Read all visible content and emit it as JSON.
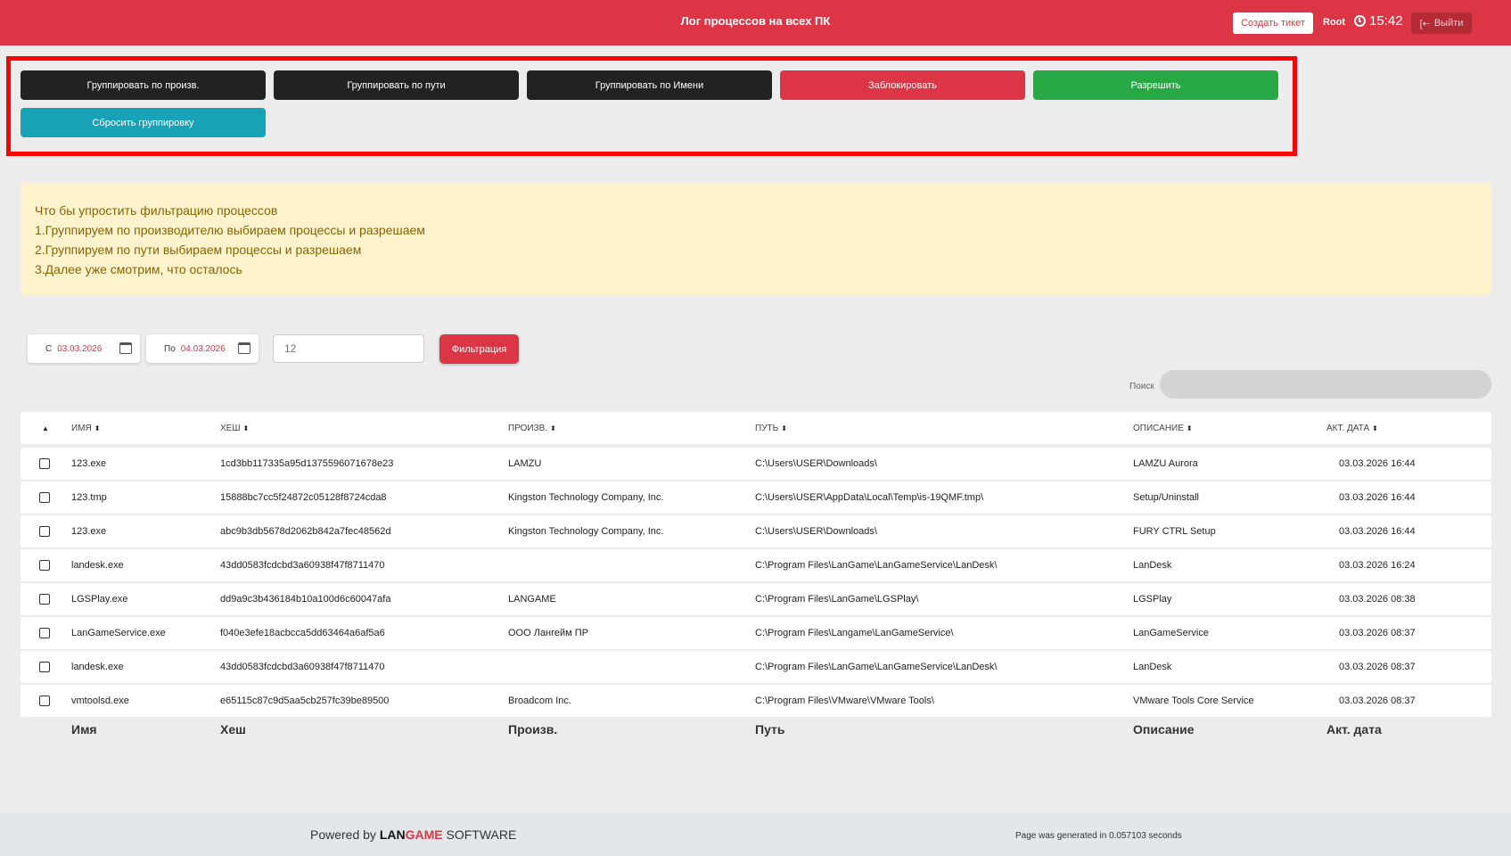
{
  "header": {
    "title": "Лог процессов на всех ПК",
    "create_ticket": "Создать тикет",
    "user": "Root",
    "time": "15:42",
    "logout": "Выйти"
  },
  "actions": {
    "group_by_vendor": "Группировать по произв.",
    "group_by_path": "Группировать по пути",
    "group_by_name": "Группировать по Имени",
    "block": "Заблокировать",
    "allow": "Разрешить",
    "reset_grouping": "Сбросить группировку"
  },
  "info": {
    "lines": [
      "Что бы упростить фильтрацию процессов",
      "1.Группируем по производителю выбираем процессы и разрешаем",
      "2.Группируем по пути выбираем процессы и разрешаем",
      "3.Далее уже смотрим, что осталось"
    ]
  },
  "filter": {
    "from_label": "С",
    "from_value": "03.03.2026",
    "to_label": "По",
    "to_value": "04.03.2026",
    "count_placeholder": "12",
    "filter_button": "Фильтрация",
    "search_label": "Поиск"
  },
  "table": {
    "headers": {
      "name": "Имя",
      "hash": "Хеш",
      "vendor": "Произв.",
      "path": "Путь",
      "description": "Описание",
      "date": "Акт. дата"
    },
    "rows": [
      {
        "name": "123.exe",
        "hash": "1cd3bb117335a95d1375596071678e23",
        "vendor": "LAMZU",
        "path": "C:\\Users\\USER\\Downloads\\",
        "description": "LAMZU Aurora",
        "date": "03.03.2026 16:44"
      },
      {
        "name": "123.tmp",
        "hash": "15888bc7cc5f24872c05128f8724cda8",
        "vendor": "Kingston Technology Company, Inc.",
        "path": "C:\\Users\\USER\\AppData\\Local\\Temp\\is-19QMF.tmp\\",
        "description": "Setup/Uninstall",
        "date": "03.03.2026 16:44"
      },
      {
        "name": "123.exe",
        "hash": "abc9b3db5678d2062b842a7fec48562d",
        "vendor": "Kingston Technology Company, Inc.",
        "path": "C:\\Users\\USER\\Downloads\\",
        "description": "FURY CTRL Setup",
        "date": "03.03.2026 16:44"
      },
      {
        "name": "landesk.exe",
        "hash": "43dd0583fcdcbd3a60938f47f8711470",
        "vendor": "",
        "path": "C:\\Program Files\\LanGame\\LanGameService\\LanDesk\\",
        "description": "LanDesk",
        "date": "03.03.2026 16:24"
      },
      {
        "name": "LGSPlay.exe",
        "hash": "dd9a9c3b436184b10a100d6c60047afa",
        "vendor": "LANGAME",
        "path": "C:\\Program Files\\LanGame\\LGSPlay\\",
        "description": "LGSPlay",
        "date": "03.03.2026 08:38"
      },
      {
        "name": "LanGameService.exe",
        "hash": "f040e3efe18acbcca5dd63464a6af5a6",
        "vendor": "ООО Лангейм ПР",
        "path": "C:\\Program Files\\Langame\\LanGameService\\",
        "description": "LanGameService",
        "date": "03.03.2026 08:37"
      },
      {
        "name": "landesk.exe",
        "hash": "43dd0583fcdcbd3a60938f47f8711470",
        "vendor": "",
        "path": "C:\\Program Files\\LanGame\\LanGameService\\LanDesk\\",
        "description": "LanDesk",
        "date": "03.03.2026 08:37"
      },
      {
        "name": "vmtoolsd.exe",
        "hash": "e65115c87c9d5aa5cb257fc39be89500",
        "vendor": "Broadcom Inc.",
        "path": "C:\\Program Files\\VMware\\VMware Tools\\",
        "description": "VMware Tools Core Service",
        "date": "03.03.2026 08:37"
      }
    ]
  },
  "footer": {
    "powered_by": "Powered by",
    "brand_lan": "LAN",
    "brand_game": "GAME",
    "brand_software": "SOFTWARE",
    "generated": "Page was generated in 0.057103 seconds"
  }
}
